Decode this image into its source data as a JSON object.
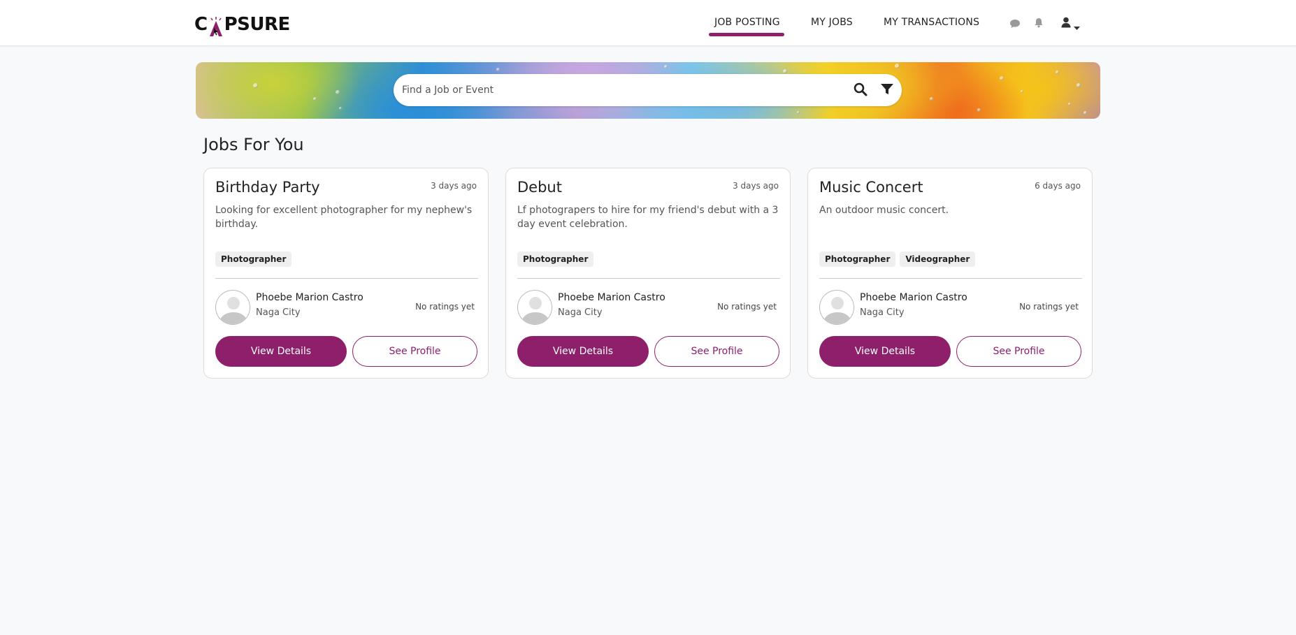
{
  "brand": {
    "name_prefix": "C",
    "name_suffix": "PSURE",
    "accent_color": "#8e1f6b"
  },
  "nav": {
    "links": [
      {
        "label": "JOB POSTING",
        "active": true
      },
      {
        "label": "MY JOBS",
        "active": false
      },
      {
        "label": "MY TRANSACTIONS",
        "active": false
      }
    ],
    "icons": [
      "chat-icon",
      "bell-icon",
      "user-icon",
      "caret-down-icon"
    ]
  },
  "search": {
    "placeholder": "Find a Job or Event",
    "value": "",
    "icons": [
      "search-icon",
      "filter-icon"
    ]
  },
  "section_title": "Jobs For You",
  "jobs": [
    {
      "title": "Birthday Party",
      "posted": "3 days ago",
      "description": "Looking for excellent photographer for my nephew's birthday.",
      "tags": [
        "Photographer"
      ],
      "poster": {
        "name": "Phoebe Marion Castro",
        "city": "Naga City",
        "rating": "No ratings yet"
      },
      "view_label": "View Details",
      "profile_label": "See Profile"
    },
    {
      "title": "Debut",
      "posted": "3 days ago",
      "description": "Lf photograpers to hire for my friend's debut with a 3 day event celebration.",
      "tags": [
        "Photographer"
      ],
      "poster": {
        "name": "Phoebe Marion Castro",
        "city": "Naga City",
        "rating": "No ratings yet"
      },
      "view_label": "View Details",
      "profile_label": "See Profile"
    },
    {
      "title": "Music Concert",
      "posted": "6 days ago",
      "description": "An outdoor music concert.",
      "tags": [
        "Photographer",
        "Videographer"
      ],
      "poster": {
        "name": "Phoebe Marion Castro",
        "city": "Naga City",
        "rating": "No ratings yet"
      },
      "view_label": "View Details",
      "profile_label": "See Profile"
    }
  ]
}
